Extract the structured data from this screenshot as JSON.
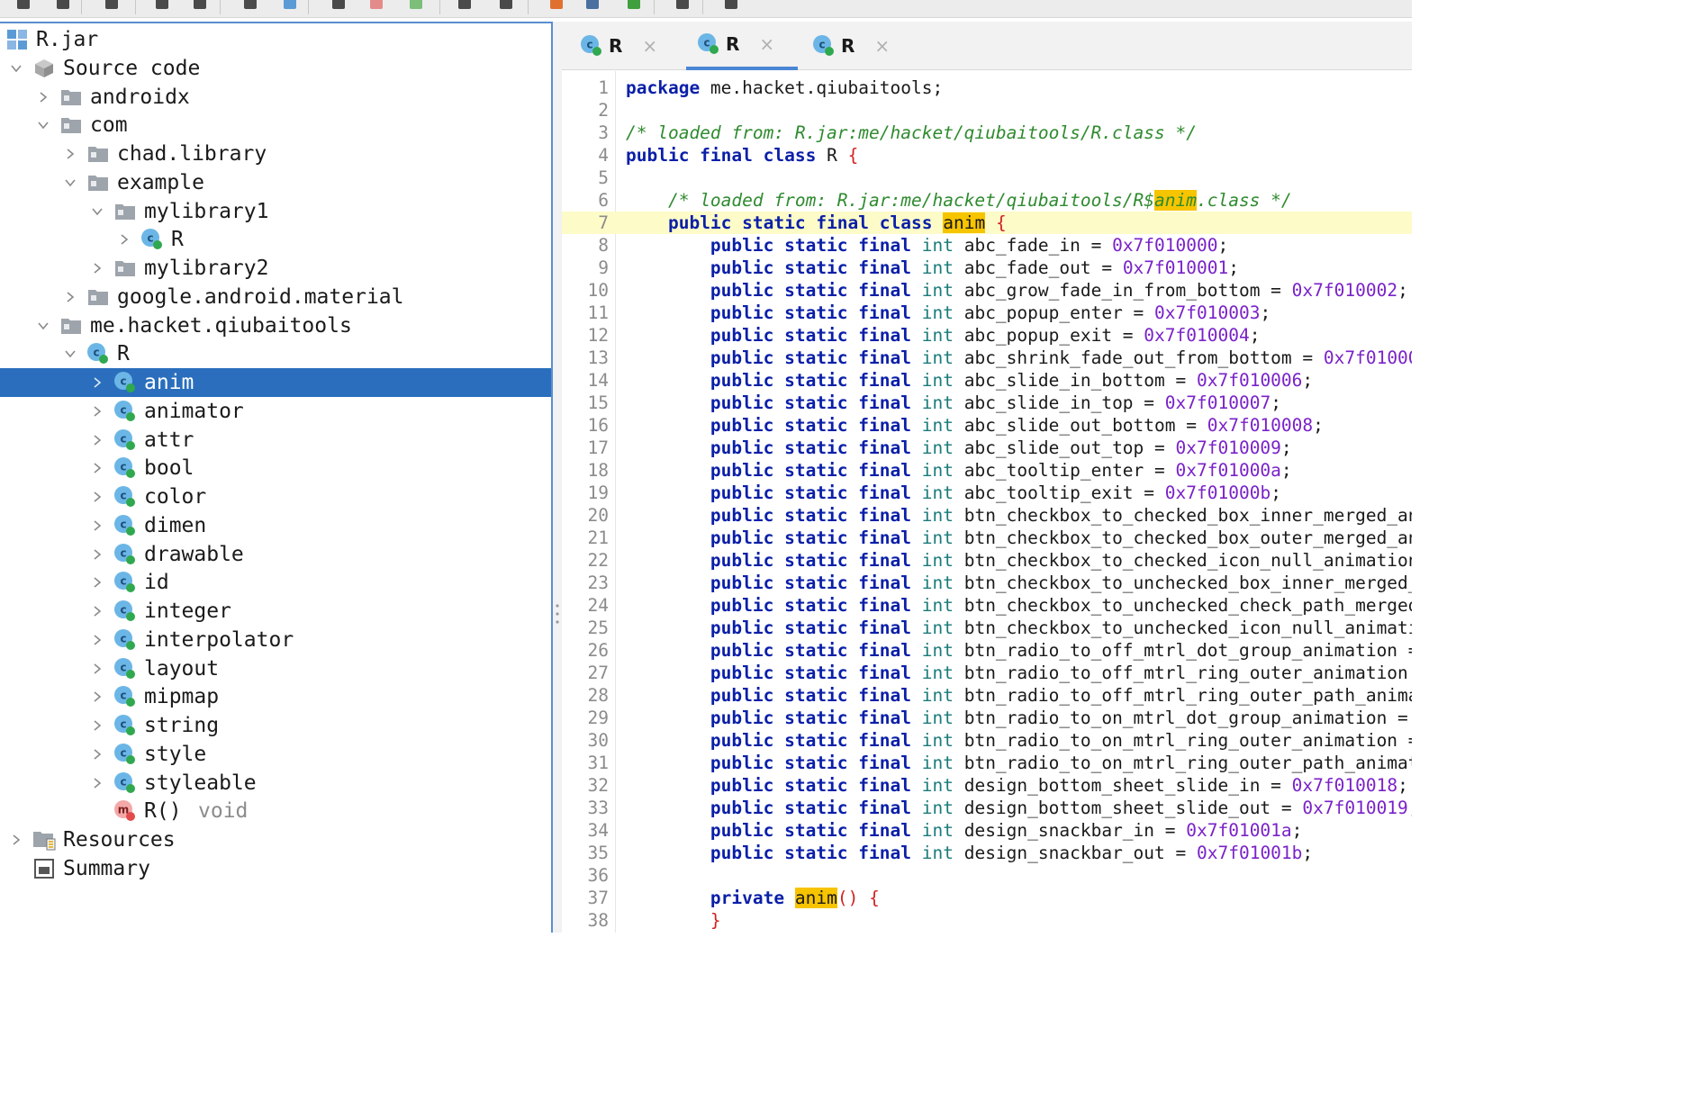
{
  "toolbar": {
    "icons": [
      "open-icon",
      "add-files-icon",
      "reload-icon",
      "save-icon",
      "export-icon",
      "export-gradle-icon",
      "flatten-packages-icon",
      "search-icon",
      "search-class-icon",
      "search-text-icon",
      "back-icon",
      "forward-icon",
      "deobfuscation-icon",
      "quark-icon",
      "debug-icon",
      "log-icon",
      "settings-icon"
    ]
  },
  "tree": {
    "root": "R.jar",
    "items": [
      {
        "label": "Source code",
        "type": "source",
        "depth": 1,
        "expanded": true
      },
      {
        "label": "androidx",
        "type": "package",
        "depth": 2,
        "expanded": false
      },
      {
        "label": "com",
        "type": "package",
        "depth": 2,
        "expanded": true
      },
      {
        "label": "chad.library",
        "type": "package",
        "depth": 3,
        "expanded": false
      },
      {
        "label": "example",
        "type": "package",
        "depth": 3,
        "expanded": true
      },
      {
        "label": "mylibrary1",
        "type": "package",
        "depth": 4,
        "expanded": true
      },
      {
        "label": "R",
        "type": "class",
        "depth": 5,
        "expanded": false
      },
      {
        "label": "mylibrary2",
        "type": "package",
        "depth": 4,
        "expanded": false
      },
      {
        "label": "google.android.material",
        "type": "package",
        "depth": 3,
        "expanded": false
      },
      {
        "label": "me.hacket.qiubaitools",
        "type": "package",
        "depth": 2,
        "expanded": true
      },
      {
        "label": "R",
        "type": "class",
        "depth": 3,
        "expanded": true
      },
      {
        "label": "anim",
        "type": "class",
        "depth": 4,
        "expanded": false,
        "selected": true
      },
      {
        "label": "animator",
        "type": "class",
        "depth": 4,
        "expanded": false
      },
      {
        "label": "attr",
        "type": "class",
        "depth": 4,
        "expanded": false
      },
      {
        "label": "bool",
        "type": "class",
        "depth": 4,
        "expanded": false
      },
      {
        "label": "color",
        "type": "class",
        "depth": 4,
        "expanded": false
      },
      {
        "label": "dimen",
        "type": "class",
        "depth": 4,
        "expanded": false
      },
      {
        "label": "drawable",
        "type": "class",
        "depth": 4,
        "expanded": false
      },
      {
        "label": "id",
        "type": "class",
        "depth": 4,
        "expanded": false
      },
      {
        "label": "integer",
        "type": "class",
        "depth": 4,
        "expanded": false
      },
      {
        "label": "interpolator",
        "type": "class",
        "depth": 4,
        "expanded": false
      },
      {
        "label": "layout",
        "type": "class",
        "depth": 4,
        "expanded": false
      },
      {
        "label": "mipmap",
        "type": "class",
        "depth": 4,
        "expanded": false
      },
      {
        "label": "string",
        "type": "class",
        "depth": 4,
        "expanded": false
      },
      {
        "label": "style",
        "type": "class",
        "depth": 4,
        "expanded": false
      },
      {
        "label": "styleable",
        "type": "class",
        "depth": 4,
        "expanded": false
      },
      {
        "label": "R()",
        "sub": "void",
        "type": "method",
        "depth": 4
      },
      {
        "label": "Resources",
        "type": "resources",
        "depth": 1,
        "expanded": false
      },
      {
        "label": "Summary",
        "type": "summary",
        "depth": 1
      }
    ]
  },
  "tabs": [
    {
      "label": "R",
      "active": false
    },
    {
      "label": "R",
      "active": true
    },
    {
      "label": "R",
      "active": false
    }
  ],
  "tab_close": "×",
  "editor": {
    "highlight_line": 7,
    "lines": [
      [
        [
          "kw",
          "package"
        ],
        [
          "t",
          " me.hacket.qiubaitools;"
        ]
      ],
      [],
      [
        [
          "cmt",
          "/* loaded from: R.jar:me/hacket/qiubaitools/R.class */"
        ]
      ],
      [
        [
          "kw",
          "public final class"
        ],
        [
          "t",
          " R "
        ],
        [
          "brace",
          "{"
        ]
      ],
      [],
      [
        [
          "t",
          "    "
        ],
        [
          "cmt",
          "/* loaded from: R.jar:me/hacket/qiubaitools/R$"
        ],
        [
          "cmtmark",
          "anim"
        ],
        [
          "cmt",
          ".class */"
        ]
      ],
      [
        [
          "t",
          "    "
        ],
        [
          "kw",
          "public static final class"
        ],
        [
          "t",
          " "
        ],
        [
          "mark",
          "anim"
        ],
        [
          "t",
          " "
        ],
        [
          "brace",
          "{"
        ]
      ],
      [
        [
          "t",
          "        "
        ],
        [
          "kw",
          "public static final"
        ],
        [
          "t",
          " "
        ],
        [
          "typ",
          "int"
        ],
        [
          "t",
          " abc_fade_in = "
        ],
        [
          "num",
          "0x7f010000"
        ],
        [
          "t",
          ";"
        ]
      ],
      [
        [
          "t",
          "        "
        ],
        [
          "kw",
          "public static final"
        ],
        [
          "t",
          " "
        ],
        [
          "typ",
          "int"
        ],
        [
          "t",
          " abc_fade_out = "
        ],
        [
          "num",
          "0x7f010001"
        ],
        [
          "t",
          ";"
        ]
      ],
      [
        [
          "t",
          "        "
        ],
        [
          "kw",
          "public static final"
        ],
        [
          "t",
          " "
        ],
        [
          "typ",
          "int"
        ],
        [
          "t",
          " abc_grow_fade_in_from_bottom = "
        ],
        [
          "num",
          "0x7f010002"
        ],
        [
          "t",
          ";"
        ]
      ],
      [
        [
          "t",
          "        "
        ],
        [
          "kw",
          "public static final"
        ],
        [
          "t",
          " "
        ],
        [
          "typ",
          "int"
        ],
        [
          "t",
          " abc_popup_enter = "
        ],
        [
          "num",
          "0x7f010003"
        ],
        [
          "t",
          ";"
        ]
      ],
      [
        [
          "t",
          "        "
        ],
        [
          "kw",
          "public static final"
        ],
        [
          "t",
          " "
        ],
        [
          "typ",
          "int"
        ],
        [
          "t",
          " abc_popup_exit = "
        ],
        [
          "num",
          "0x7f010004"
        ],
        [
          "t",
          ";"
        ]
      ],
      [
        [
          "t",
          "        "
        ],
        [
          "kw",
          "public static final"
        ],
        [
          "t",
          " "
        ],
        [
          "typ",
          "int"
        ],
        [
          "t",
          " abc_shrink_fade_out_from_bottom = "
        ],
        [
          "num",
          "0x7f01000"
        ]
      ],
      [
        [
          "t",
          "        "
        ],
        [
          "kw",
          "public static final"
        ],
        [
          "t",
          " "
        ],
        [
          "typ",
          "int"
        ],
        [
          "t",
          " abc_slide_in_bottom = "
        ],
        [
          "num",
          "0x7f010006"
        ],
        [
          "t",
          ";"
        ]
      ],
      [
        [
          "t",
          "        "
        ],
        [
          "kw",
          "public static final"
        ],
        [
          "t",
          " "
        ],
        [
          "typ",
          "int"
        ],
        [
          "t",
          " abc_slide_in_top = "
        ],
        [
          "num",
          "0x7f010007"
        ],
        [
          "t",
          ";"
        ]
      ],
      [
        [
          "t",
          "        "
        ],
        [
          "kw",
          "public static final"
        ],
        [
          "t",
          " "
        ],
        [
          "typ",
          "int"
        ],
        [
          "t",
          " abc_slide_out_bottom = "
        ],
        [
          "num",
          "0x7f010008"
        ],
        [
          "t",
          ";"
        ]
      ],
      [
        [
          "t",
          "        "
        ],
        [
          "kw",
          "public static final"
        ],
        [
          "t",
          " "
        ],
        [
          "typ",
          "int"
        ],
        [
          "t",
          " abc_slide_out_top = "
        ],
        [
          "num",
          "0x7f010009"
        ],
        [
          "t",
          ";"
        ]
      ],
      [
        [
          "t",
          "        "
        ],
        [
          "kw",
          "public static final"
        ],
        [
          "t",
          " "
        ],
        [
          "typ",
          "int"
        ],
        [
          "t",
          " abc_tooltip_enter = "
        ],
        [
          "num",
          "0x7f01000a"
        ],
        [
          "t",
          ";"
        ]
      ],
      [
        [
          "t",
          "        "
        ],
        [
          "kw",
          "public static final"
        ],
        [
          "t",
          " "
        ],
        [
          "typ",
          "int"
        ],
        [
          "t",
          " abc_tooltip_exit = "
        ],
        [
          "num",
          "0x7f01000b"
        ],
        [
          "t",
          ";"
        ]
      ],
      [
        [
          "t",
          "        "
        ],
        [
          "kw",
          "public static final"
        ],
        [
          "t",
          " "
        ],
        [
          "typ",
          "int"
        ],
        [
          "t",
          " btn_checkbox_to_checked_box_inner_merged_an"
        ]
      ],
      [
        [
          "t",
          "        "
        ],
        [
          "kw",
          "public static final"
        ],
        [
          "t",
          " "
        ],
        [
          "typ",
          "int"
        ],
        [
          "t",
          " btn_checkbox_to_checked_box_outer_merged_an"
        ]
      ],
      [
        [
          "t",
          "        "
        ],
        [
          "kw",
          "public static final"
        ],
        [
          "t",
          " "
        ],
        [
          "typ",
          "int"
        ],
        [
          "t",
          " btn_checkbox_to_checked_icon_null_animation"
        ]
      ],
      [
        [
          "t",
          "        "
        ],
        [
          "kw",
          "public static final"
        ],
        [
          "t",
          " "
        ],
        [
          "typ",
          "int"
        ],
        [
          "t",
          " btn_checkbox_to_unchecked_box_inner_merged_"
        ]
      ],
      [
        [
          "t",
          "        "
        ],
        [
          "kw",
          "public static final"
        ],
        [
          "t",
          " "
        ],
        [
          "typ",
          "int"
        ],
        [
          "t",
          " btn_checkbox_to_unchecked_check_path_merged"
        ]
      ],
      [
        [
          "t",
          "        "
        ],
        [
          "kw",
          "public static final"
        ],
        [
          "t",
          " "
        ],
        [
          "typ",
          "int"
        ],
        [
          "t",
          " btn_checkbox_to_unchecked_icon_null_animati"
        ]
      ],
      [
        [
          "t",
          "        "
        ],
        [
          "kw",
          "public static final"
        ],
        [
          "t",
          " "
        ],
        [
          "typ",
          "int"
        ],
        [
          "t",
          " btn_radio_to_off_mtrl_dot_group_animation ="
        ]
      ],
      [
        [
          "t",
          "        "
        ],
        [
          "kw",
          "public static final"
        ],
        [
          "t",
          " "
        ],
        [
          "typ",
          "int"
        ],
        [
          "t",
          " btn_radio_to_off_mtrl_ring_outer_animation "
        ]
      ],
      [
        [
          "t",
          "        "
        ],
        [
          "kw",
          "public static final"
        ],
        [
          "t",
          " "
        ],
        [
          "typ",
          "int"
        ],
        [
          "t",
          " btn_radio_to_off_mtrl_ring_outer_path_anima"
        ]
      ],
      [
        [
          "t",
          "        "
        ],
        [
          "kw",
          "public static final"
        ],
        [
          "t",
          " "
        ],
        [
          "typ",
          "int"
        ],
        [
          "t",
          " btn_radio_to_on_mtrl_dot_group_animation ="
        ]
      ],
      [
        [
          "t",
          "        "
        ],
        [
          "kw",
          "public static final"
        ],
        [
          "t",
          " "
        ],
        [
          "typ",
          "int"
        ],
        [
          "t",
          " btn_radio_to_on_mtrl_ring_outer_animation ="
        ]
      ],
      [
        [
          "t",
          "        "
        ],
        [
          "kw",
          "public static final"
        ],
        [
          "t",
          " "
        ],
        [
          "typ",
          "int"
        ],
        [
          "t",
          " btn_radio_to_on_mtrl_ring_outer_path_animat"
        ]
      ],
      [
        [
          "t",
          "        "
        ],
        [
          "kw",
          "public static final"
        ],
        [
          "t",
          " "
        ],
        [
          "typ",
          "int"
        ],
        [
          "t",
          " design_bottom_sheet_slide_in = "
        ],
        [
          "num",
          "0x7f010018"
        ],
        [
          "t",
          ";"
        ]
      ],
      [
        [
          "t",
          "        "
        ],
        [
          "kw",
          "public static final"
        ],
        [
          "t",
          " "
        ],
        [
          "typ",
          "int"
        ],
        [
          "t",
          " design_bottom_sheet_slide_out = "
        ],
        [
          "num",
          "0x7f010019"
        ],
        [
          "t",
          ";"
        ]
      ],
      [
        [
          "t",
          "        "
        ],
        [
          "kw",
          "public static final"
        ],
        [
          "t",
          " "
        ],
        [
          "typ",
          "int"
        ],
        [
          "t",
          " design_snackbar_in = "
        ],
        [
          "num",
          "0x7f01001a"
        ],
        [
          "t",
          ";"
        ]
      ],
      [
        [
          "t",
          "        "
        ],
        [
          "kw",
          "public static final"
        ],
        [
          "t",
          " "
        ],
        [
          "typ",
          "int"
        ],
        [
          "t",
          " design_snackbar_out = "
        ],
        [
          "num",
          "0x7f01001b"
        ],
        [
          "t",
          ";"
        ]
      ],
      [],
      [
        [
          "t",
          "        "
        ],
        [
          "kw",
          "private"
        ],
        [
          "t",
          " "
        ],
        [
          "mark",
          "anim"
        ],
        [
          "brace",
          "()"
        ],
        [
          "t",
          " "
        ],
        [
          "brace",
          "{"
        ]
      ],
      [
        [
          "t",
          "        "
        ],
        [
          "brace",
          "}"
        ]
      ]
    ]
  }
}
